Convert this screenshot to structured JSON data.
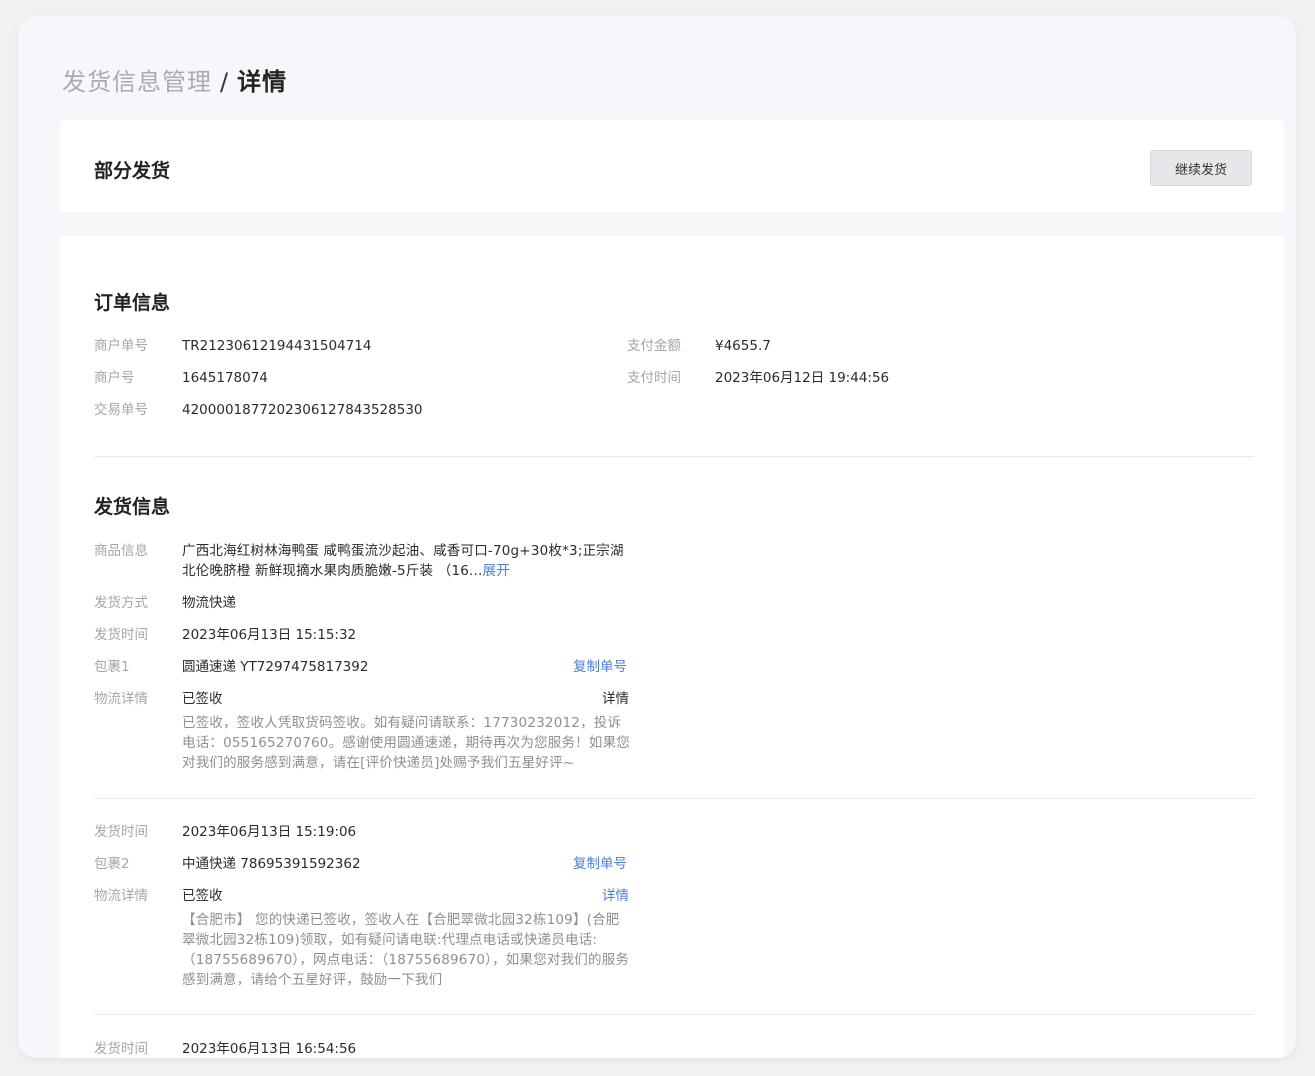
{
  "breadcrumb": {
    "parent": "发货信息管理",
    "separator": "/",
    "current": "详情"
  },
  "status": {
    "title": "部分发货",
    "continue_button": "继续发货"
  },
  "order": {
    "title": "订单信息",
    "merchant_order_no_label": "商户单号",
    "merchant_order_no": "TR21230612194431504714",
    "merchant_no_label": "商户号",
    "merchant_no": "1645178074",
    "transaction_no_label": "交易单号",
    "transaction_no": "4200001877202306127843528530",
    "pay_amount_label": "支付金额",
    "pay_amount": "¥4655.7",
    "pay_time_label": "支付时间",
    "pay_time": "2023年06月12日 19:44:56"
  },
  "shipping": {
    "title": "发货信息",
    "goods_label": "商品信息",
    "goods_text": "广西北海红树林海鸭蛋 咸鸭蛋流沙起油、咸香可口-70g+30枚*3;正宗湖北伦晚脐橙 新鲜现摘水果肉质脆嫩-5斤装 （16...",
    "goods_expand": "展开",
    "method_label": "发货方式",
    "method": "物流快递",
    "packages": [
      {
        "ship_time_label": "发货时间",
        "ship_time": "2023年06月13日 15:15:32",
        "package_label": "包裹1",
        "carrier_tracking": "圆通速递 YT7297475817392",
        "copy_label": "复制单号",
        "logistics_label": "物流详情",
        "logistics_status": "已签收",
        "detail_label": "详情",
        "logistics_text": "已签收，签收人凭取货码签收。如有疑问请联系：17730232012，投诉电话：055165270760。感谢使用圆通速递，期待再次为您服务！如果您对我们的服务感到满意，请在[评价快递员]处赐予我们五星好评~"
      },
      {
        "ship_time_label": "发货时间",
        "ship_time": "2023年06月13日 15:19:06",
        "package_label": "包裹2",
        "carrier_tracking": "中通快递 78695391592362",
        "copy_label": "复制单号",
        "logistics_label": "物流详情",
        "logistics_status": "已签收",
        "detail_label": "详情",
        "logistics_text": "【合肥市】 您的快递已签收，签收人在【合肥翠微北园32栋109】(合肥翠微北园32栋109)领取，如有疑问请电联:代理点电话或快递员电话:（18755689670），网点电话：（18755689670），如果您对我们的服务感到满意，请给个五星好评，鼓励一下我们"
      },
      {
        "ship_time_label": "发货时间",
        "ship_time": "2023年06月13日 16:54:56"
      }
    ]
  }
}
